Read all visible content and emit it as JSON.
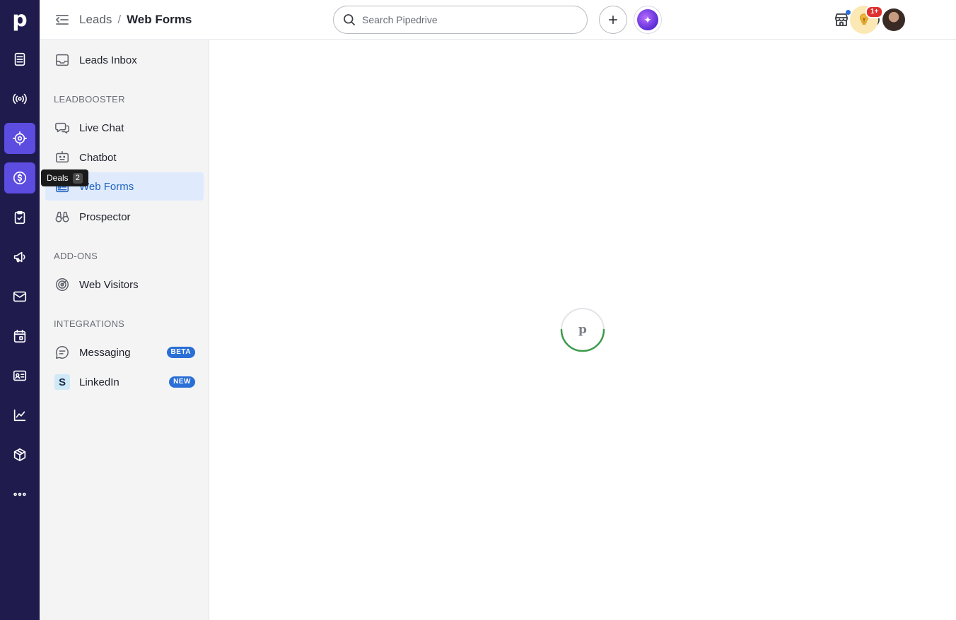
{
  "rail": {
    "logo": "p",
    "items": [
      {
        "icon": "leads-icon"
      },
      {
        "icon": "broadcast-icon"
      },
      {
        "icon": "target-icon"
      },
      {
        "icon": "dollar-icon"
      },
      {
        "icon": "activities-icon"
      },
      {
        "icon": "megaphone-icon"
      },
      {
        "icon": "mail-icon"
      },
      {
        "icon": "calendar-icon"
      },
      {
        "icon": "contacts-icon"
      },
      {
        "icon": "insights-icon"
      },
      {
        "icon": "products-icon"
      },
      {
        "icon": "more-icon"
      }
    ],
    "tooltip": {
      "label": "Deals",
      "count": "2"
    }
  },
  "header": {
    "breadcrumb_parent": "Leads",
    "breadcrumb_sep": "/",
    "breadcrumb_current": "Web Forms",
    "search_placeholder": "Search Pipedrive",
    "tips_badge": "1+"
  },
  "subnav": {
    "leads_inbox": "Leads Inbox",
    "leadbooster_title": "LEADBOOSTER",
    "live_chat": "Live Chat",
    "chatbot": "Chatbot",
    "web_forms": "Web Forms",
    "prospector": "Prospector",
    "addons_title": "ADD-ONS",
    "web_visitors": "Web Visitors",
    "integrations_title": "INTEGRATIONS",
    "messaging": "Messaging",
    "messaging_badge": "BETA",
    "linkedin": "LinkedIn",
    "linkedin_badge": "NEW",
    "linkedin_glyph": "S"
  },
  "loader": {
    "glyph": "p"
  },
  "colors": {
    "rail_bg": "#1f1b4d",
    "rail_active": "#5c4ce0",
    "active_item_bg": "#dfeafc",
    "accent_blue": "#2a6fd6",
    "loader_green": "#3c9a4b"
  }
}
